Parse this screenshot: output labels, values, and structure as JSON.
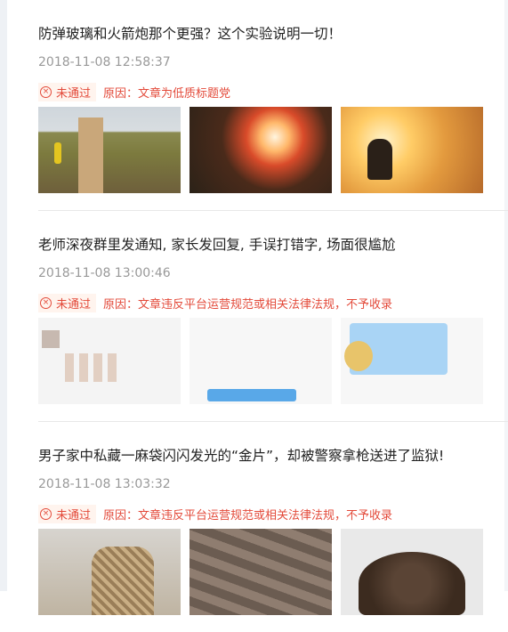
{
  "articles": [
    {
      "title": "防弹玻璃和火箭炮那个更强？这个实验说明一切！",
      "timestamp": "2018-11-08 12:58:37",
      "status": "未通过",
      "reason": "原因：文章为低质标题党"
    },
    {
      "title": "老师深夜群里发通知, 家长发回复, 手误打错字, 场面很尴尬",
      "timestamp": "2018-11-08 13:00:46",
      "status": "未通过",
      "reason": "原因：文章违反平台运营规范或相关法律法规，不予收录"
    },
    {
      "title": "男子家中私藏一麻袋闪闪发光的“金片”，却被警察拿枪送进了监狱!",
      "timestamp": "2018-11-08 13:03:32",
      "status": "未通过",
      "reason": "原因：文章违反平台运营规范或相关法律法规，不予收录"
    }
  ],
  "colors": {
    "reject": "#e34a3a",
    "meta": "#999999",
    "title": "#222222"
  },
  "icons": {
    "status": "reject-circle-icon"
  }
}
